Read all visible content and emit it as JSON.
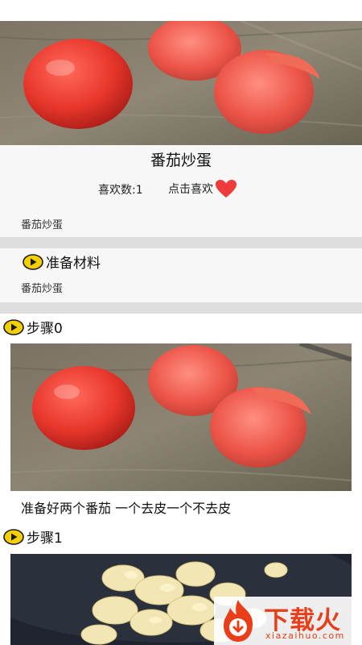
{
  "recipe": {
    "title": "番茄炒蛋",
    "like_count_label": "喜欢数:1",
    "like_action_label": "点击喜欢",
    "description": "番茄炒蛋"
  },
  "ingredients": {
    "heading": "准备材料",
    "content": "番茄炒蛋"
  },
  "steps": [
    {
      "heading": "步骤0",
      "image": "tomatoes-on-cutting-board",
      "text": "准备好两个番茄 一个去皮一个不去皮"
    },
    {
      "heading": "步骤1",
      "image": "scrambled-eggs-in-pan",
      "text": ""
    }
  ],
  "watermark": {
    "name": "下载火",
    "domain": "xiazaihuo.com"
  },
  "colors": {
    "heart": "#ee3b3b",
    "play_icon_fill": "#f5d000",
    "watermark": "#e83e1a",
    "divider": "#dedede"
  }
}
